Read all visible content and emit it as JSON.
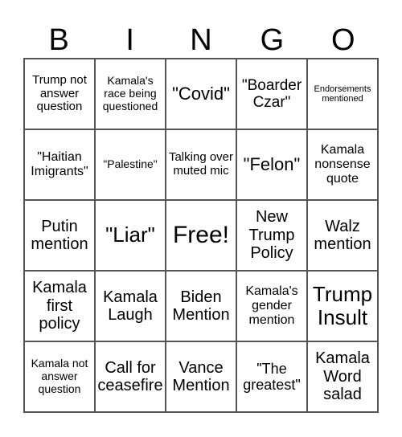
{
  "header": [
    "B",
    "I",
    "N",
    "G",
    "O"
  ],
  "cells": [
    "Trump not answer question",
    "Kamala's race being questioned",
    "\"Covid\"",
    "\"Boarder Czar\"",
    "Endorsements mentioned",
    "\"Haitian Imigrants\"",
    "\"Palestine\"",
    "Talking over muted mic",
    "\"Felon\"",
    "Kamala nonsense quote",
    "Putin mention",
    "\"Liar\"",
    "Free!",
    "New Trump Policy",
    "Walz mention",
    "Kamala first policy",
    "Kamala Laugh",
    "Biden Mention",
    "Kamala's gender mention",
    "Trump Insult",
    "Kamala not answer question",
    "Call for ceasefire",
    "Vance Mention",
    "\"The greatest\"",
    "Kamala Word salad"
  ]
}
